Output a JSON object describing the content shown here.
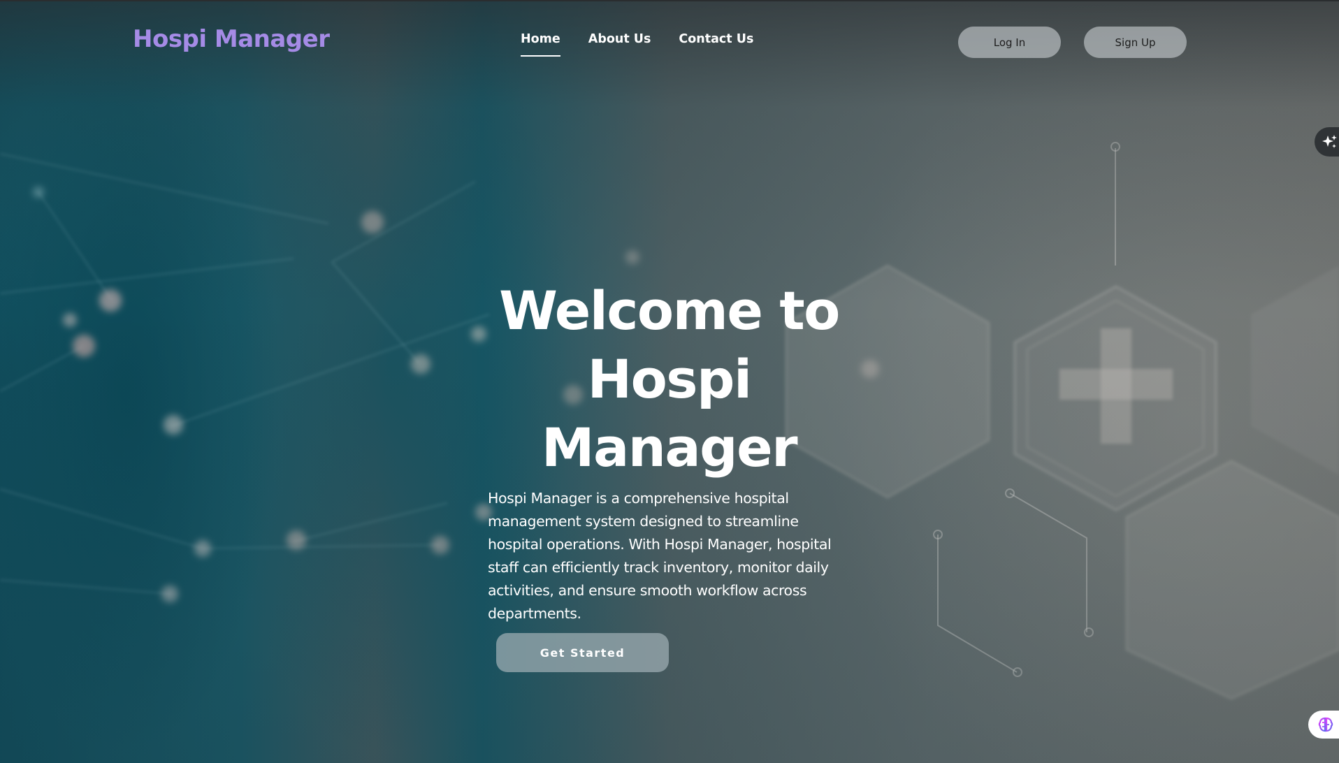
{
  "brand": {
    "name": "Hospi Manager"
  },
  "nav": {
    "items": [
      {
        "label": "Home",
        "active": true
      },
      {
        "label": "About Us",
        "active": false
      },
      {
        "label": "Contact Us",
        "active": false
      }
    ]
  },
  "auth": {
    "login_label": "Log In",
    "signup_label": "Sign Up"
  },
  "hero": {
    "title_lines": [
      "Welcome to",
      "Hospi",
      "Manager"
    ],
    "description": "Hospi Manager is a comprehensive hospital management system designed to streamline hospital operations. With Hospi Manager, hospital staff can efficiently track inventory, monitor daily activities, and ensure smooth workflow across departments.",
    "cta_label": "Get  Started"
  },
  "widgets": {
    "ai_icon": "sparkle-icon",
    "brain_icon": "brain-icon"
  },
  "colors": {
    "brand": "#a58be6",
    "button_bg": "#c8cdd0",
    "text": "#ffffff"
  }
}
